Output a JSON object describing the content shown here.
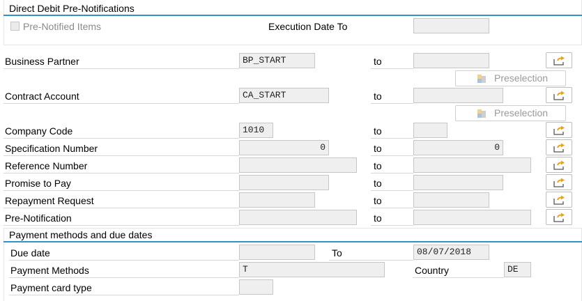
{
  "group1": {
    "title": "Direct Debit Pre-Notifications",
    "checkbox_label": "Pre-Notified Items",
    "checkbox_checked": false,
    "execution_date_to_label": "Execution Date To",
    "execution_date_to_value": ""
  },
  "to_label": "to",
  "preselection_label": "Preselection",
  "rows": {
    "business_partner": {
      "label": "Business Partner",
      "from": "BP_START",
      "to": ""
    },
    "contract_account": {
      "label": "Contract Account",
      "from": "CA_START",
      "to": ""
    },
    "company_code": {
      "label": "Company Code",
      "from": "1010",
      "to": ""
    },
    "specification_number": {
      "label": "Specification Number",
      "from": "0",
      "to": "0"
    },
    "reference_number": {
      "label": "Reference Number",
      "from": "",
      "to": ""
    },
    "promise_to_pay": {
      "label": "Promise to Pay",
      "from": "",
      "to": ""
    },
    "repayment_request": {
      "label": "Repayment Request",
      "from": "",
      "to": ""
    },
    "pre_notification": {
      "label": "Pre-Notification",
      "from": "",
      "to": ""
    }
  },
  "group2": {
    "title": "Payment methods and due dates",
    "due_date_label": "Due date",
    "due_date_value": "",
    "due_date_to_label": "To",
    "due_date_to_value": "08/07/2018",
    "payment_methods_label": "Payment Methods",
    "payment_methods_value": "T",
    "country_label": "Country",
    "country_value": "DE",
    "payment_card_type_label": "Payment card type",
    "payment_card_type_value": ""
  },
  "colors": {
    "group_accent": "#2f93c7",
    "input_bg": "#efefef",
    "icon_arrow": "#e8a317"
  },
  "icons": {
    "multiple_selection": "arrow-right-box-icon",
    "preselection": "puzzle-pieces-icon"
  }
}
